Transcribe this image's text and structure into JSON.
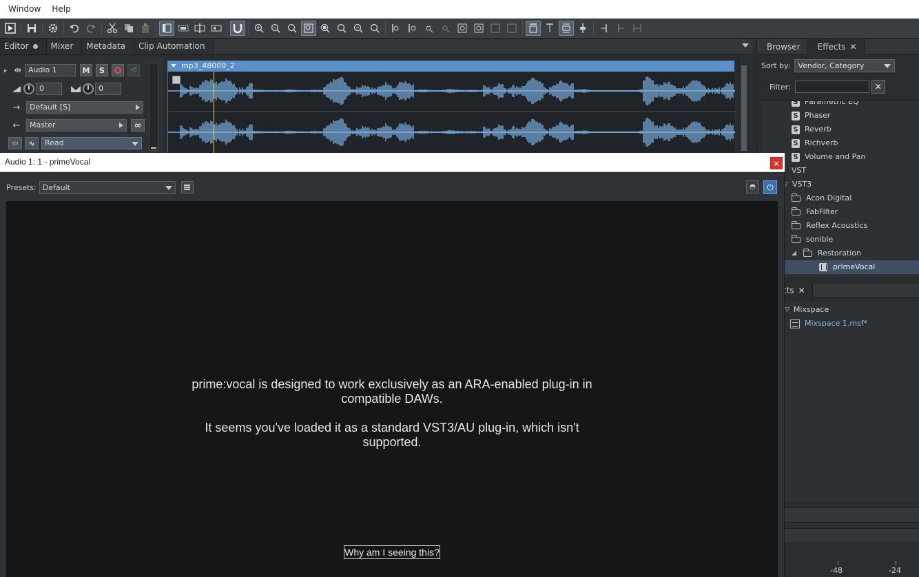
{
  "menu": [
    "Window",
    "Help"
  ],
  "editor_tabs": [
    {
      "label": "Editor",
      "modified": true
    },
    {
      "label": "Mixer"
    },
    {
      "label": "Metadata"
    },
    {
      "label": "Clip Automation"
    }
  ],
  "track": {
    "name": "Audio 1",
    "mute": "M",
    "solo": "S",
    "volume": "0",
    "pan": "0",
    "input": "Default [S]",
    "output": "Master",
    "automation_mode": "Read"
  },
  "clip": {
    "name": "mp3_48000_2"
  },
  "right_panel": {
    "tabs": [
      {
        "label": "Browser"
      },
      {
        "label": "Effects"
      }
    ],
    "sort_label": "Sort by:",
    "sort_value": "Vendor, Category",
    "filter_label": "Filter:",
    "filter_value": "",
    "filter_clear": "✕",
    "tree": [
      {
        "label": "Parametric EQ",
        "type": "s"
      },
      {
        "label": "Phaser",
        "type": "s"
      },
      {
        "label": "Reverb",
        "type": "s"
      },
      {
        "label": "Richverb",
        "type": "s"
      },
      {
        "label": "Volume and Pan",
        "type": "s"
      },
      {
        "label": "VST",
        "type": "group"
      },
      {
        "label": "VST3",
        "type": "group",
        "expanded": true
      },
      {
        "label": "Acon Digital",
        "type": "folder"
      },
      {
        "label": "FabFilter",
        "type": "folder"
      },
      {
        "label": "Reflex Acoustics",
        "type": "folder"
      },
      {
        "label": "sonible",
        "type": "folder-open"
      },
      {
        "label": "Restoration",
        "type": "folder-open"
      },
      {
        "label": "primeVocal",
        "type": "plugin",
        "selected": true
      }
    ],
    "mixspace_tab": "cts",
    "mixspace_group": "Mixspace",
    "mixspace_file": "Mixspace 1.msf*",
    "meter_labels": [
      "-48",
      "-24"
    ]
  },
  "plugin_window": {
    "title": "Audio 1: 1 - primeVocal",
    "close": "×",
    "presets_label": "Presets:",
    "presets_value": "Default",
    "message_1": "prime:vocal is designed to work exclusively as an ARA-enabled plug-in in compatible DAWs.",
    "message_2": "It seems you've loaded it as a standard VST3/AU plug-in, which isn't supported.",
    "why_button": "Why am I seeing this?"
  },
  "colors": {
    "clip_header": "#5b8fc7",
    "waveform": "#7aaee0",
    "playhead": "#e8e24a",
    "close_red": "#d9342b",
    "power_blue": "#3f6fa8"
  }
}
